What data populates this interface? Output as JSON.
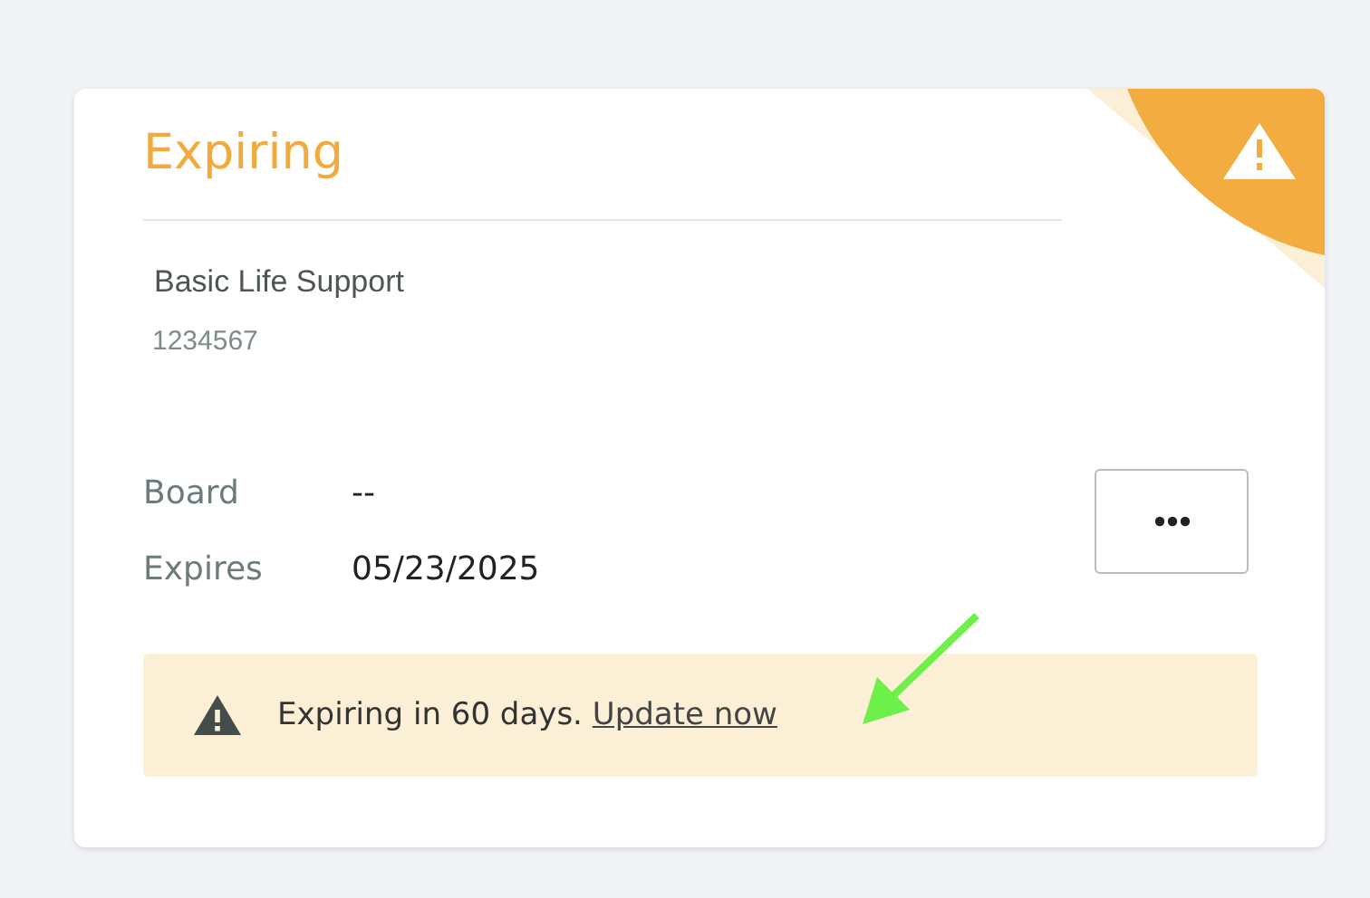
{
  "card": {
    "status": "Expiring",
    "certification": {
      "name": "Basic Life Support",
      "number": "1234567"
    },
    "details": [
      {
        "label": "Board",
        "value": "--"
      },
      {
        "label": "Expires",
        "value": "05/23/2025"
      }
    ],
    "alert": {
      "message": "Expiring in 60 days.",
      "link": "Update now"
    }
  }
}
